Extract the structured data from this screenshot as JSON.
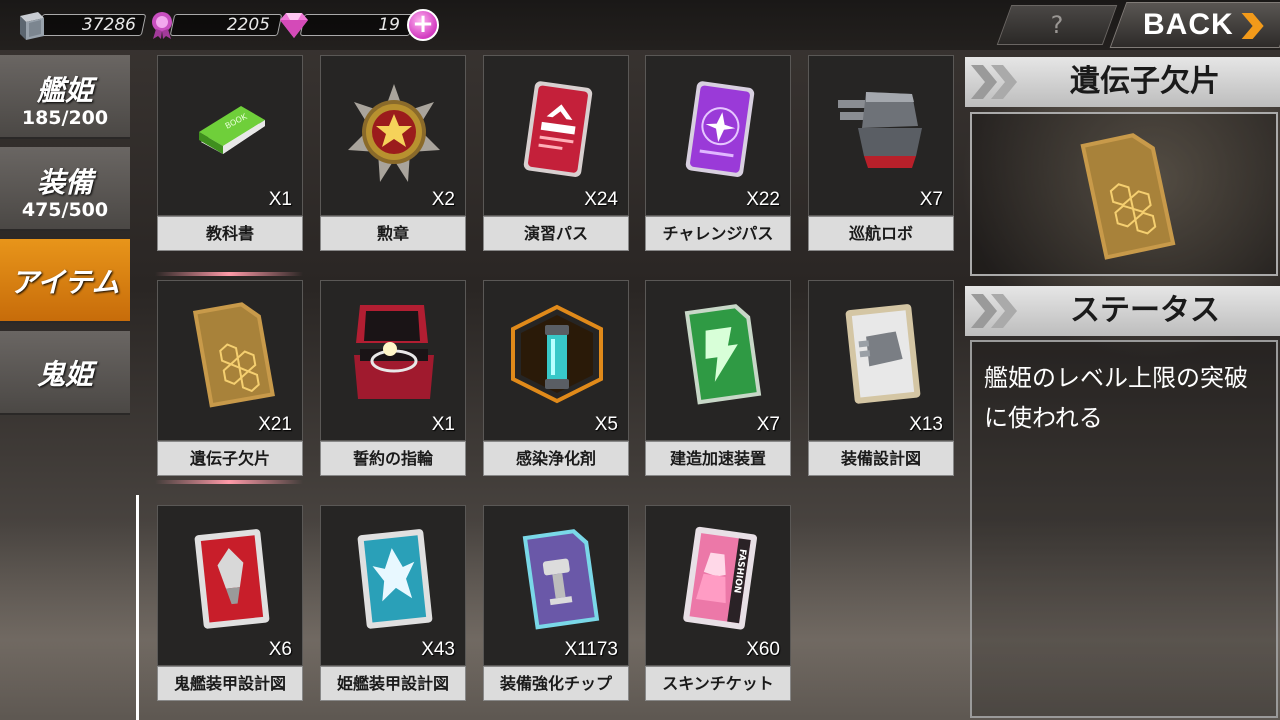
{
  "topbar": {
    "resource1": {
      "value": "37286",
      "icon": "book-stack-icon"
    },
    "resource2": {
      "value": "2205",
      "icon": "medal-icon"
    },
    "resource3": {
      "value": "19",
      "icon": "gem-icon"
    },
    "add_icon": "plus-icon",
    "help_label": "?",
    "back_label": "BACK"
  },
  "tabs": [
    {
      "label": "艦姫",
      "count": "185/200"
    },
    {
      "label": "装備",
      "count": "475/500"
    },
    {
      "label": "アイテム",
      "count": ""
    },
    {
      "label": "鬼姫",
      "count": ""
    }
  ],
  "active_tab": "アイテム",
  "items": [
    {
      "name": "教科書",
      "qty": "X1",
      "icon": "book-icon",
      "icon_text": "BOOK"
    },
    {
      "name": "勲章",
      "qty": "X2",
      "icon": "medal-star-icon"
    },
    {
      "name": "演習パス",
      "qty": "X24",
      "icon": "red-pass-icon"
    },
    {
      "name": "チャレンジパス",
      "qty": "X22",
      "icon": "purple-pass-icon"
    },
    {
      "name": "巡航ロボ",
      "qty": "X7",
      "icon": "turret-robot-icon"
    },
    {
      "name": "遺伝子欠片",
      "qty": "X21",
      "icon": "gene-fragment-icon"
    },
    {
      "name": "誓約の指輪",
      "qty": "X1",
      "icon": "ring-box-icon"
    },
    {
      "name": "感染浄化剤",
      "qty": "X5",
      "icon": "purifier-capsule-icon"
    },
    {
      "name": "建造加速装置",
      "qty": "X7",
      "icon": "green-accelerator-icon"
    },
    {
      "name": "装備設計図",
      "qty": "X13",
      "icon": "equipment-blueprint-icon"
    },
    {
      "name": "鬼艦装甲設計図",
      "qty": "X6",
      "icon": "red-blueprint-icon"
    },
    {
      "name": "姫艦装甲設計図",
      "qty": "X43",
      "icon": "blue-blueprint-icon"
    },
    {
      "name": "装備強化チップ",
      "qty": "X1173",
      "icon": "enhance-chip-icon"
    },
    {
      "name": "スキンチケット",
      "qty": "X60",
      "icon": "skin-ticket-icon",
      "icon_text": "FASHION"
    }
  ],
  "detail": {
    "title": "遺伝子欠片",
    "status_title": "ステータス",
    "description": "艦姫のレベル上限の突破に使われる"
  },
  "colors": {
    "active_tab": "#e0880f",
    "label_bg": "#dcdcdc",
    "accent_pink": "#d23ac0"
  }
}
